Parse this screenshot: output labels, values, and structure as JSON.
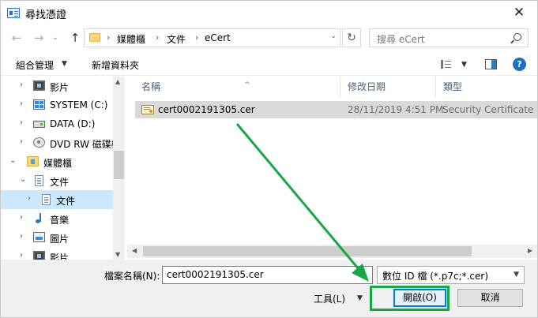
{
  "window": {
    "title": "尋找憑證",
    "close_glyph": "✕"
  },
  "address": {
    "breadcrumbs": [
      "媒體櫃",
      "文件",
      "eCert"
    ],
    "separator": "›",
    "search_placeholder": "搜尋 eCert",
    "back_glyph": "←",
    "forward_glyph": "→",
    "recent_glyph": "⌄",
    "up_glyph": "↑",
    "dropdown_glyph": "⌄",
    "refresh_glyph": "↻"
  },
  "toolbar": {
    "organize_label": "組合管理",
    "new_folder_label": "新增資料夾",
    "help_label": "?"
  },
  "nav": {
    "items": [
      {
        "label": "影片",
        "icon": "video-icon",
        "chevron": "›"
      },
      {
        "label": "SYSTEM (C:)",
        "icon": "windows-drive-icon",
        "chevron": "›"
      },
      {
        "label": "DATA (D:)",
        "icon": "drive-icon",
        "chevron": "›"
      },
      {
        "label": "DVD RW 磁碟機",
        "icon": "dvd-icon",
        "chevron": "›"
      },
      {
        "label": "媒體櫃",
        "icon": "library-folder-icon",
        "chevron": "⌄"
      },
      {
        "label": "文件",
        "icon": "document-icon",
        "chevron": "⌄"
      },
      {
        "label": "文件",
        "icon": "document-icon",
        "chevron": "›",
        "selected": true
      },
      {
        "label": "音樂",
        "icon": "music-icon",
        "chevron": "›"
      },
      {
        "label": "圖片",
        "icon": "picture-icon",
        "chevron": "›"
      },
      {
        "label": "影片",
        "icon": "video-icon",
        "chevron": "›"
      }
    ]
  },
  "filelist": {
    "columns": [
      "名稱",
      "修改日期",
      "類型"
    ],
    "sort_glyph": "^",
    "rows": [
      {
        "name": "cert0002191305.cer",
        "modified": "28/11/2019 4:51 PM",
        "type": "Security Certificate",
        "icon": "certificate-icon"
      }
    ]
  },
  "bottom": {
    "filename_label": "檔案名稱(N):",
    "filename_value": "cert0002191305.cer",
    "filetype_value": "數位 ID 檔 (*.p7c;*.cer)",
    "tools_label": "工具(L)",
    "open_label": "開啟(O)",
    "cancel_label": "取消"
  },
  "colors": {
    "annotation": "#1aa647",
    "selection": "#cce8ff",
    "accent": "#0078d7"
  }
}
